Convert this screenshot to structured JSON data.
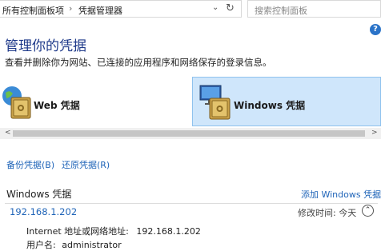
{
  "address_bar": {
    "crumbs": [
      "所有控制面板项",
      "凭据管理器"
    ],
    "separator": "›",
    "dropdown_icon": "chevron-down-icon",
    "refresh_icon": "refresh-icon"
  },
  "search": {
    "placeholder": "搜索控制面板"
  },
  "help": {
    "label": "?"
  },
  "header": {
    "title": "管理你的凭据",
    "description": "查看并删除你为网站、已连接的应用程序和网络保存的登录信息。"
  },
  "tiles": [
    {
      "label": "Web 凭据",
      "icon": "web-credential-vault-icon",
      "selected": false
    },
    {
      "label": "Windows 凭据",
      "icon": "windows-credential-vault-icon",
      "selected": true
    }
  ],
  "scroll": {
    "left": "<",
    "right": ">"
  },
  "actions": {
    "backup": "备份凭据(B)",
    "restore": "还原凭据(R)"
  },
  "section": {
    "title": "Windows 凭据",
    "add_link": "添加 Windows 凭据"
  },
  "entry": {
    "name": "192.168.1.202",
    "modified": "修改时间:  今天",
    "collapse_icon": "chevron-up-icon",
    "address_label": "Internet 地址或网络地址:",
    "address_value": "192.168.1.202",
    "user_label": "用户名:",
    "user_value": "administrator"
  },
  "colors": {
    "accent": "#1f64b8",
    "title": "#1f3a8a",
    "selected_tile": "#cfe6fb"
  }
}
